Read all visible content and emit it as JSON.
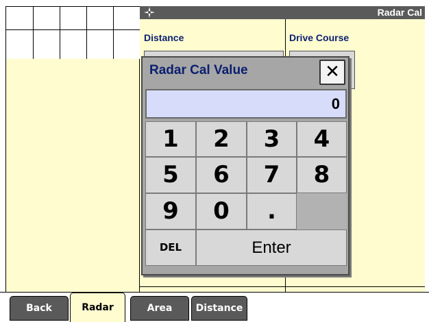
{
  "title_bar": {
    "title": "Radar Cal",
    "logo_icon": "compass-logo-icon"
  },
  "columns": {
    "distance_header": "Distance",
    "drive_course_header": "Drive Course"
  },
  "dialog": {
    "title": "Radar Cal Value",
    "close_label": "✕",
    "display_value": "0",
    "keys_row1": [
      "1",
      "2",
      "3",
      "4"
    ],
    "keys_row2": [
      "5",
      "6",
      "7",
      "8"
    ],
    "keys_row3": [
      "9",
      "0",
      "."
    ],
    "del_label": "DEL",
    "enter_label": "Enter"
  },
  "tabs": [
    {
      "label": "Back",
      "active": false
    },
    {
      "label": "Radar",
      "active": true
    },
    {
      "label": "Area",
      "active": false
    },
    {
      "label": "Distance",
      "active": false
    }
  ],
  "colors": {
    "panel": "#fffcd0",
    "title_bar": "#5a5a5a",
    "heading_text": "#0a1f70",
    "display_bg": "#d7dcfa",
    "dialog_bg": "#a6a6a6"
  }
}
